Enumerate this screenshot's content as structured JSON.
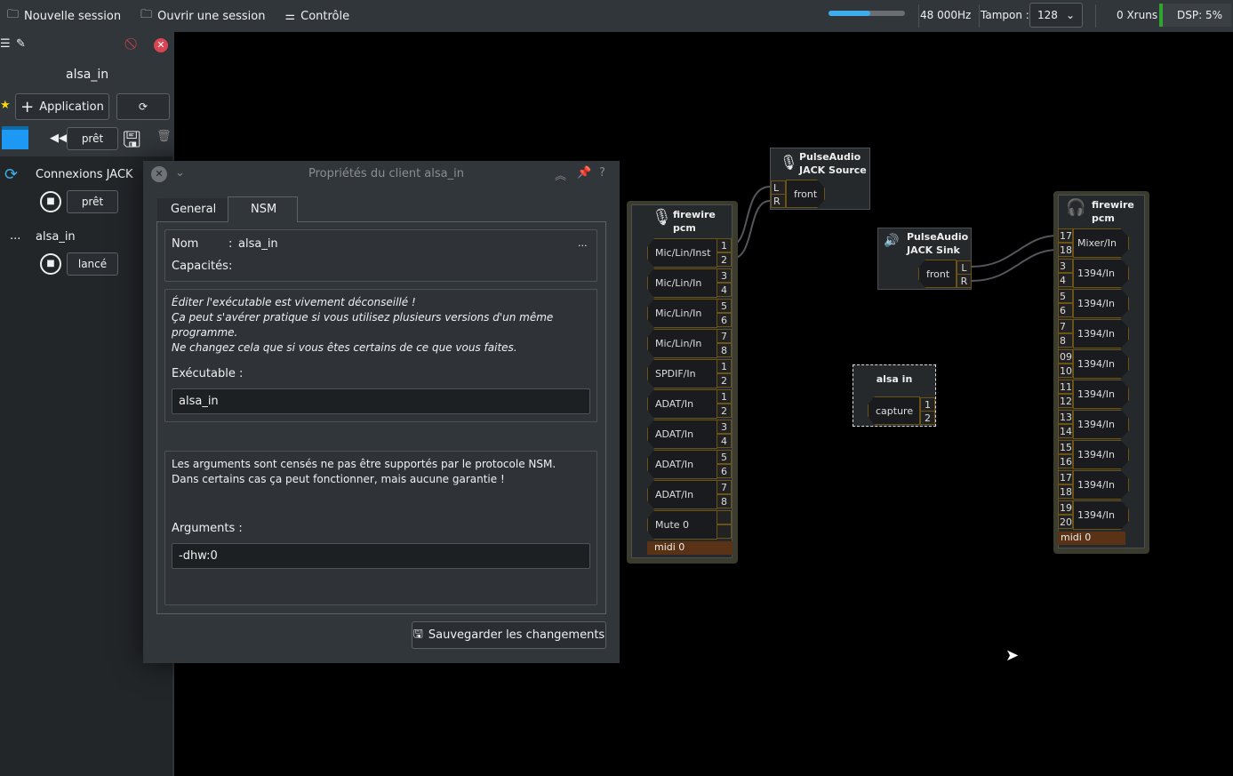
{
  "topbar": {
    "new_session": "Nouvelle session",
    "open_session": "Ouvrir une session",
    "control": "Contrôle",
    "samplerate": "48 000Hz",
    "buffer_label": "Tampon :",
    "buffer_value": "128",
    "xruns": "0 Xruns",
    "dsp": "DSP: 5%",
    "volume_fraction": 0.55
  },
  "sidebar": {
    "session_name": "alsa_in",
    "add_app": "Application",
    "session_status": "prêt",
    "clients": [
      {
        "name": "Connexions JACK",
        "status": "prêt"
      },
      {
        "name": "alsa_in",
        "status": "lancé",
        "prefix": "..."
      }
    ]
  },
  "dialog": {
    "title": "Propriétés du client alsa_in",
    "tabs": [
      "General",
      "NSM"
    ],
    "nom_label": "Nom",
    "nom_value": "alsa_in",
    "capacites_label": "Capacités",
    "colon": ":",
    "more": "...",
    "warning": [
      "Éditer l'exécutable est vivement déconseillé !",
      "Ça peut s'avérer pratique si vous utilisez plusieurs versions d'un même programme.",
      "Ne changez cela que si vous êtes certains de ce que vous faites."
    ],
    "exec_label": "Exécutable :",
    "exec_value": "alsa_in",
    "args_note": [
      "Les arguments sont censés ne pas être supportés par le protocole NSM.",
      "Dans certains cas ça peut fonctionner, mais aucune garantie !"
    ],
    "args_label": "Arguments :",
    "args_value": "-dhw:0",
    "save": "Sauvegarder les changements"
  },
  "canvas": {
    "fw_capture": {
      "title1": "firewire",
      "title2": "pcm",
      "ports": [
        [
          "Mic/Lin/Inst",
          "1",
          "2"
        ],
        [
          "Mic/Lin/In",
          "3",
          "4"
        ],
        [
          "Mic/Lin/In",
          "5",
          "6"
        ],
        [
          "Mic/Lin/In",
          "7",
          "8"
        ],
        [
          "SPDIF/In",
          "1",
          "2"
        ],
        [
          "ADAT/In",
          "1",
          "2"
        ],
        [
          "ADAT/In",
          "3",
          "4"
        ],
        [
          "ADAT/In",
          "5",
          "6"
        ],
        [
          "ADAT/In",
          "7",
          "8"
        ],
        [
          "Mute 0",
          "",
          ""
        ]
      ],
      "midi": "midi 0"
    },
    "pa_source": {
      "title1": "PulseAudio",
      "title2": "JACK Source",
      "port": "front",
      "l": "L",
      "r": "R"
    },
    "pa_sink": {
      "title1": "PulseAudio",
      "title2": "JACK Sink",
      "port": "front",
      "l": "L",
      "r": "R"
    },
    "alsa_in": {
      "title": "alsa in",
      "port": "capture",
      "n1": "1",
      "n2": "2"
    },
    "fw_playback": {
      "title1": "firewire",
      "title2": "pcm",
      "ports": [
        [
          "Mixer/In",
          "17",
          "18"
        ],
        [
          "1394/In",
          "3",
          "4"
        ],
        [
          "1394/In",
          "5",
          "6"
        ],
        [
          "1394/In",
          "7",
          "8"
        ],
        [
          "1394/In",
          "09",
          "10"
        ],
        [
          "1394/In",
          "11",
          "12"
        ],
        [
          "1394/In",
          "13",
          "14"
        ],
        [
          "1394/In",
          "15",
          "16"
        ],
        [
          "1394/In",
          "17",
          "18"
        ],
        [
          "1394/In",
          "19",
          "20"
        ]
      ],
      "midi": "midi 0"
    }
  }
}
